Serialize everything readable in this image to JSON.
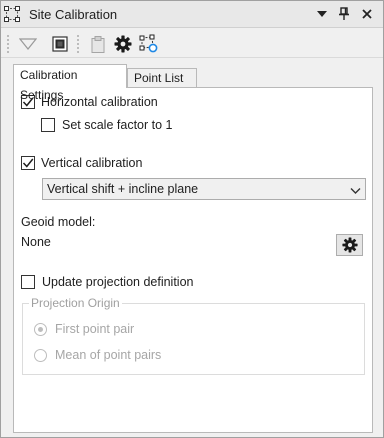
{
  "window": {
    "title": "Site Calibration"
  },
  "tabs": [
    {
      "label": "Calibration Settings",
      "active": true
    },
    {
      "label": "Point List",
      "active": false
    }
  ],
  "settings": {
    "horizontal": {
      "label": "Horizontal calibration",
      "checked": true
    },
    "scale_factor": {
      "label": "Set scale factor to 1",
      "checked": false
    },
    "vertical": {
      "label": "Vertical calibration",
      "checked": true
    },
    "vertical_method": {
      "selected": "Vertical shift + incline plane"
    },
    "geoid": {
      "label": "Geoid model:",
      "value": "None"
    },
    "update_projection": {
      "label": "Update projection definition",
      "checked": false
    },
    "projection_origin": {
      "legend": "Projection Origin",
      "options": [
        {
          "label": "First point pair",
          "selected": true
        },
        {
          "label": "Mean of point pairs",
          "selected": false
        }
      ]
    }
  },
  "icons": {
    "title": "site-calibration-icon",
    "pin": "pin-icon",
    "close": "close-icon",
    "menu": "dropdown-arrow-icon",
    "filter": "filter-icon",
    "view": "view-icon",
    "clipboard": "clipboard-icon",
    "settings": "gear-icon",
    "calibrate": "calibration-network-icon"
  },
  "colors": {
    "checkmark": "#1e1e1e",
    "disabled": "#a6a6a6",
    "accent": "#1e88e5"
  }
}
